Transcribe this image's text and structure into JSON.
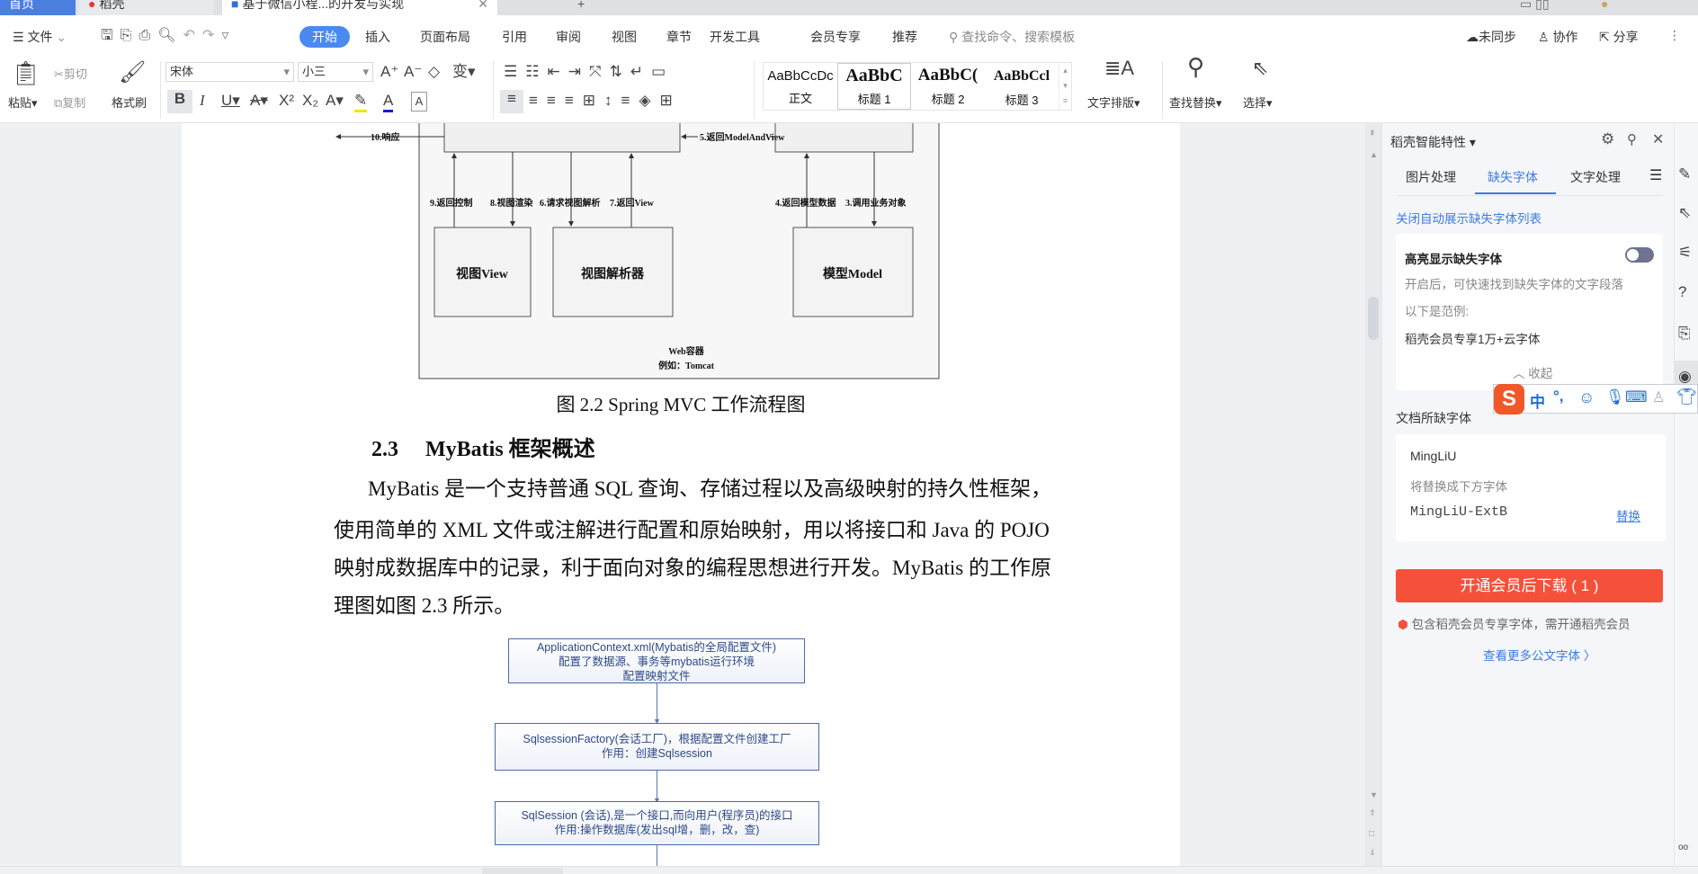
{
  "tabs": [
    {
      "label": "首页"
    },
    {
      "label": "稻壳"
    },
    {
      "label": "基于微信小程...的开发与实现"
    }
  ],
  "menu": {
    "file": "文件",
    "items": [
      "开始",
      "插入",
      "页面布局",
      "引用",
      "审阅",
      "视图",
      "章节",
      "开发工具",
      "会员专享",
      "推荐"
    ],
    "search_placeholder": "查找命令、搜索模板",
    "sync": "未同步",
    "collab": "协作",
    "share": "分享"
  },
  "toolbar": {
    "paste": "粘贴",
    "cut": "剪切",
    "copy": "复制",
    "format_painter": "格式刷",
    "font": "宋体",
    "size": "小三",
    "styles": [
      {
        "preview": "AaBbCcDc",
        "label": "正文"
      },
      {
        "preview": "AaBbC",
        "label": "标题 1"
      },
      {
        "preview": "AaBbC(",
        "label": "标题 2"
      },
      {
        "preview": "AaBbCcl",
        "label": "标题 3"
      }
    ],
    "text_layout": "文字排版",
    "find_replace": "查找替换",
    "select": "选择",
    "colors": {
      "highlight": "#f5e400",
      "font_color": "#1a1ad0"
    }
  },
  "doc": {
    "diagram": {
      "labels": {
        "response": "10.响应",
        "return_mav": "5.返回ModelAndView",
        "l9": "9.返回控制",
        "l8": "8.视图渲染",
        "l6": "6.请求视图解析",
        "l7": "7.返回View",
        "l4": "4.返回模型数据",
        "l3": "3.调用业务对象",
        "view": "视图View",
        "resolver": "视图解析器",
        "model": "模型Model",
        "container": "Web容器",
        "example": "例如：Tomcat"
      }
    },
    "caption": "图 2.2  Spring MVC 工作流程图",
    "heading_num": "2.3",
    "heading_text": "MyBatis 框架概述",
    "para_lines": [
      "MyBatis 是一个支持普通 SQL 查询、存储过程以及高级映射的持久性框架，",
      "使用简单的 XML 文件或注解进行配置和原始映射，用以将接口和 Java 的 POJO",
      "映射成数据库中的记录，利于面向对象的编程思想进行开发。MyBatis 的工作原",
      "理图如图 2.3 所示。"
    ],
    "flow": [
      [
        "ApplicationContext.xml(Mybatis的全局配置文件)",
        "配置了数据源、事务等mybatis运行环境",
        "配置映射文件"
      ],
      [
        "SqlsessionFactory(会话工厂)，根据配置文件创建工厂",
        "作用：创建Sqlsession"
      ],
      [
        "SqlSession (会话),是一个接口,而向用户(程序员)的接口",
        "作用:操作数据库(发出sql增，删，改，查)"
      ]
    ]
  },
  "panel": {
    "title": "稻壳智能特性",
    "tabs": [
      "图片处理",
      "缺失字体",
      "文字处理"
    ],
    "active_tab": "缺失字体",
    "close_auto_link": "关闭自动展示缺失字体列表",
    "highlight_title": "高亮显示缺失字体",
    "highlight_on": false,
    "highlight_desc": "开启后，可快速找到缺失字体的文字段落",
    "example_label": "以下是范例:",
    "example_text": "稻壳会员专享1万+云字体",
    "collapse": "收起",
    "missing_title": "文档所缺字体",
    "font_name": "MingLiU",
    "replace_hint": "将替换成下方字体",
    "replacement": "MingLiU-ExtB",
    "replace_link": "替换",
    "download_btn": "开通会员后下载 ( 1 )",
    "member_note": "包含稻壳会员专享字体，需开通稻壳会员",
    "more_fonts": "查看更多公文字体",
    "accent": "#3f7be0",
    "button_color": "#f5503a"
  },
  "ime": {
    "mode": "中",
    "punct": "°,"
  }
}
